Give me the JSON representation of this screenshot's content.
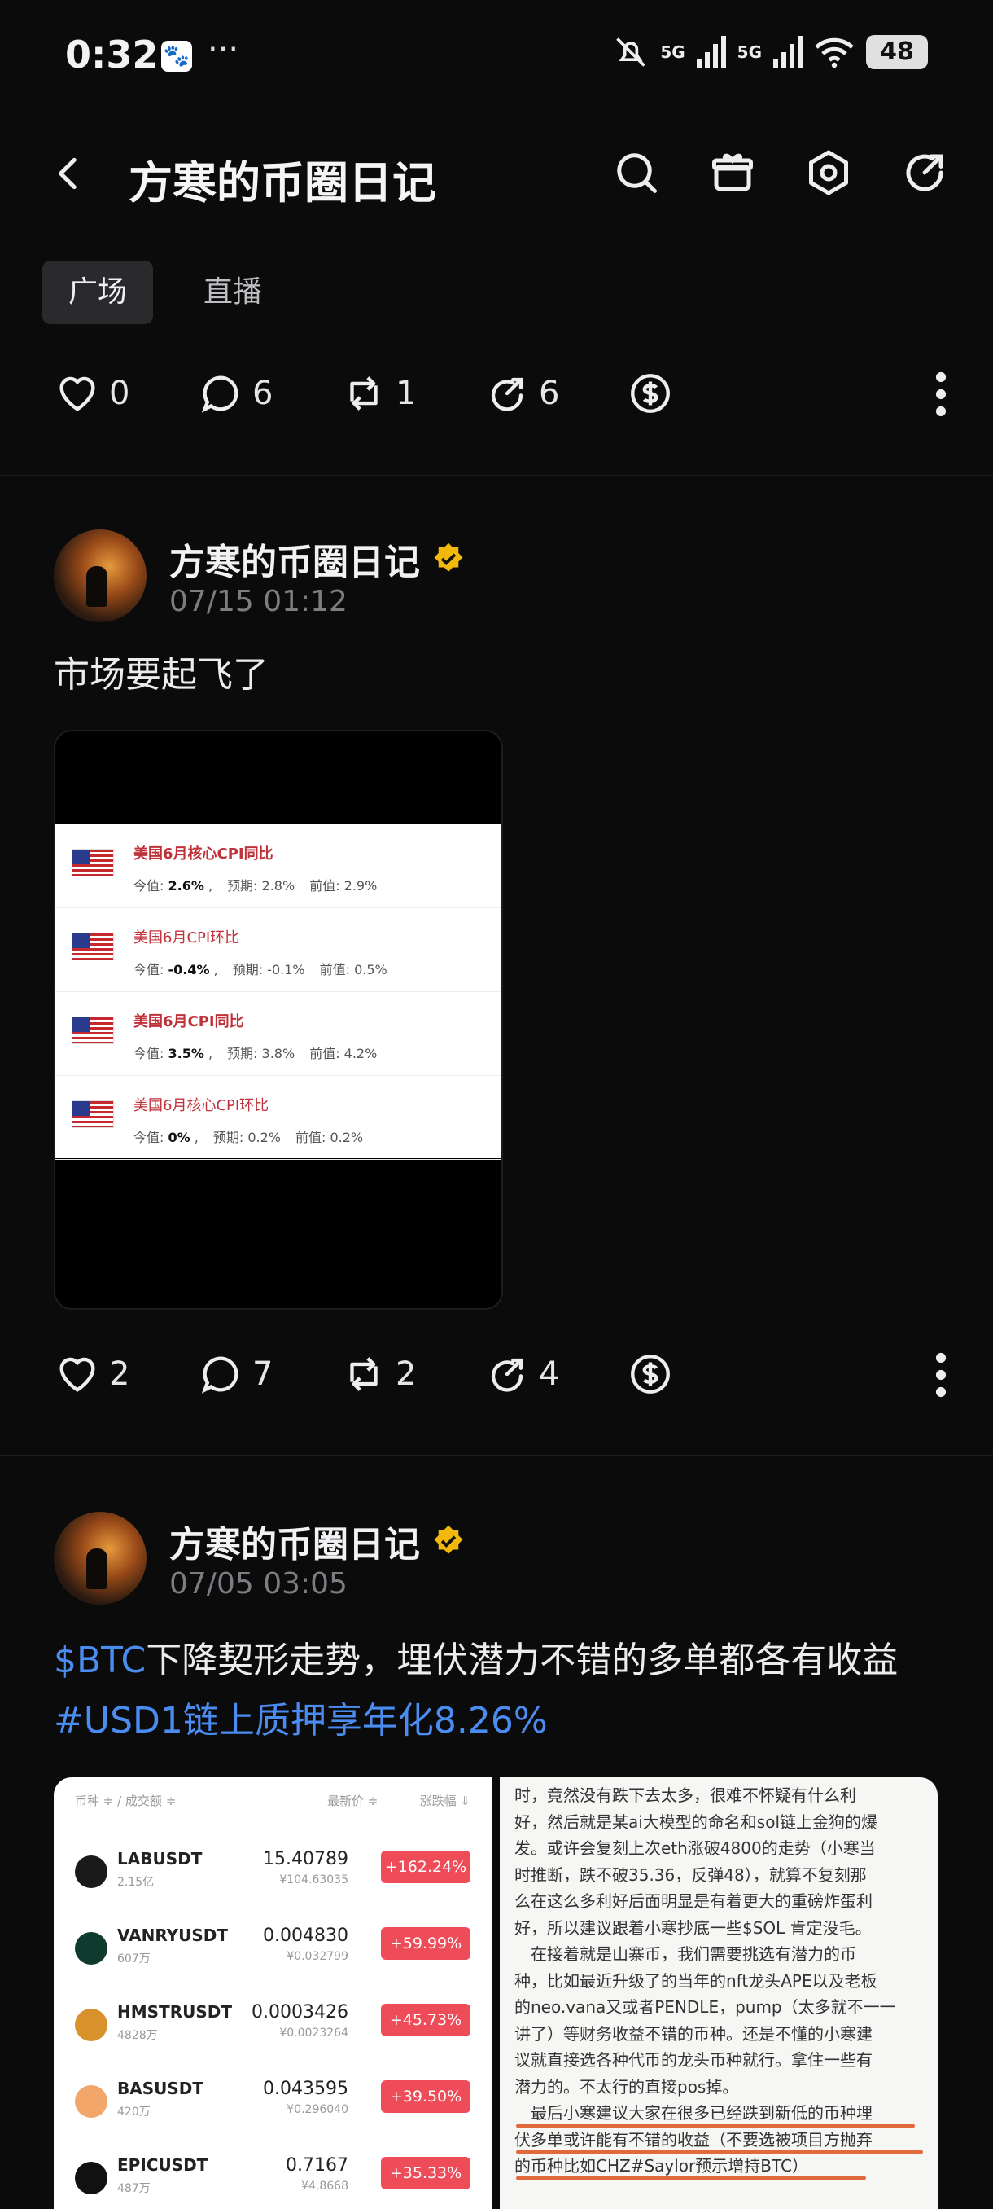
{
  "status_bar": {
    "time": "0:32",
    "net1": "5G",
    "net2": "5G",
    "battery": "48"
  },
  "header": {
    "title": "方寒的币圈日记"
  },
  "tabs": [
    {
      "label": "广场",
      "active": true
    },
    {
      "label": "直播",
      "active": false
    }
  ],
  "post0_actions": {
    "likes": "0",
    "comments": "6",
    "reposts": "1",
    "shares": "6"
  },
  "posts": [
    {
      "author": "方寒的币圈日记",
      "date": "07/15 01:12",
      "text": "市场要起飞了",
      "cpi": [
        {
          "title": "美国6月核心CPI同比",
          "now_label": "今值:",
          "now": "2.6%",
          "forecast": "预期: 2.8%",
          "prev": "前值: 2.9%",
          "bold": true
        },
        {
          "title": "美国6月CPI环比",
          "now_label": "今值:",
          "now": "-0.4%",
          "forecast": "预期: -0.1%",
          "prev": "前值: 0.5%",
          "bold": false
        },
        {
          "title": "美国6月CPI同比",
          "now_label": "今值:",
          "now": "3.5%",
          "forecast": "预期: 3.8%",
          "prev": "前值: 4.2%",
          "bold": true
        },
        {
          "title": "美国6月核心CPI环比",
          "now_label": "今值:",
          "now": "0%",
          "forecast": "预期: 0.2%",
          "prev": "前值: 0.2%",
          "bold": false
        }
      ],
      "actions": {
        "likes": "2",
        "comments": "7",
        "reposts": "2",
        "shares": "4"
      }
    },
    {
      "author": "方寒的币圈日记",
      "date": "07/05 03:05",
      "text_link1": "$BTC",
      "text_main": "下降契形走势，埋伏潜力不错的多单都各有收益",
      "text_link2": "#USD1链上质押享年化8.26%",
      "market_header": {
        "col1": "币种 ≑ / 成交额 ≑",
        "col2": "最新价 ≑",
        "col3": "涨跌幅 ⇓"
      },
      "market": [
        {
          "symbol": "LABUSDT",
          "volume": "2.15亿",
          "price": "15.40789",
          "cny": "¥104.63035",
          "change": "+162.24%",
          "color": "#1a1a1a"
        },
        {
          "symbol": "VANRYUSDT",
          "volume": "607万",
          "price": "0.004830",
          "cny": "¥0.032799",
          "change": "+59.99%",
          "color": "#0f3b2e"
        },
        {
          "symbol": "HMSTRUSDT",
          "volume": "4828万",
          "price": "0.0003426",
          "cny": "¥0.0023264",
          "change": "+45.73%",
          "color": "#d9912c"
        },
        {
          "symbol": "BASUSDT",
          "volume": "420万",
          "price": "0.043595",
          "cny": "¥0.296040",
          "change": "+39.50%",
          "color": "#f2a66a"
        },
        {
          "symbol": "EPICUSDT",
          "volume": "487万",
          "price": "0.7167",
          "cny": "¥4.8668",
          "change": "+35.33%",
          "color": "#111111"
        }
      ],
      "article_lines": [
        "时，竟然没有跌下去太多，很难不怀疑有什么利",
        "好，然后就是某ai大模型的命名和sol链上金狗的爆",
        "发。或许会复刻上次eth涨破4800的走势（小寒当",
        "时推断，跌不破35.36，反弹48），就算不复刻那",
        "么在这么多利好后面明显是有着更大的重磅炸蛋利",
        "好，所以建议跟着小寒抄底一些$SOL 肯定没毛。",
        "　在接着就是山寨币，我们需要挑选有潜力的币",
        "种，比如最近升级了的当年的nft龙头APE以及老板",
        "的neo.vana又或者PENDLE，pump（太多就不一一",
        "讲了）等财务收益不错的币种。还是不懂的小寒建",
        "议就直接选各种代币的龙头币种就行。拿住一些有",
        "潜力的。不太行的直接pos掉。",
        "　最后小寒建议大家在很多已经跌到新低的币种埋",
        "伏多单或许能有不错的收益（不要选被项目方抛弃",
        "的币种比如CHZ#Saylor预示增持BTC）"
      ]
    }
  ]
}
